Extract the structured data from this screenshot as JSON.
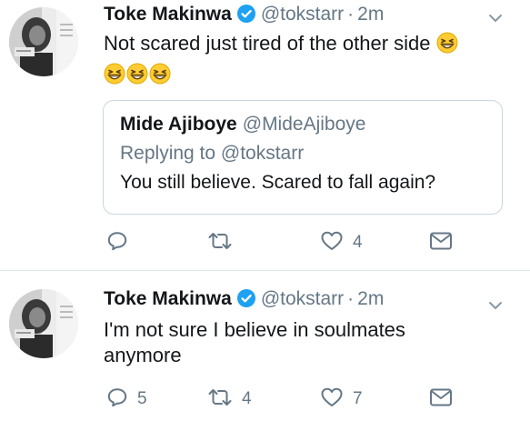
{
  "tweets": [
    {
      "display_name": "Toke Makinwa",
      "handle": "@tokstarr",
      "separator": "·",
      "time": "2m",
      "text": "Not scared just tired of the other side",
      "emoji": [
        "grinning-squint-emoji",
        "grinning-squint-emoji",
        "grinning-squint-emoji",
        "grinning-squint-emoji"
      ],
      "quote": {
        "display_name": "Mide Ajiboye",
        "handle": "@MideAjiboye",
        "replying_to": "Replying to @tokstarr",
        "text": "You still believe. Scared to fall again?"
      },
      "actions": {
        "reply_count": "",
        "retweet_count": "",
        "like_count": "4"
      }
    },
    {
      "display_name": "Toke Makinwa",
      "handle": "@tokstarr",
      "separator": "·",
      "time": "2m",
      "text": "I'm not sure I believe in soulmates anymore",
      "actions": {
        "reply_count": "5",
        "retweet_count": "4",
        "like_count": "7"
      }
    }
  ],
  "icons": {
    "verified": "verified-badge-icon",
    "caret": "chevron-down-icon",
    "reply": "reply-icon",
    "retweet": "retweet-icon",
    "like": "heart-icon",
    "dm": "envelope-icon"
  },
  "colors": {
    "verified_blue": "#1da1f2",
    "secondary_text": "#657786",
    "primary_text": "#14171a",
    "divider": "#e1e8ed",
    "icon_gray": "#657786"
  }
}
